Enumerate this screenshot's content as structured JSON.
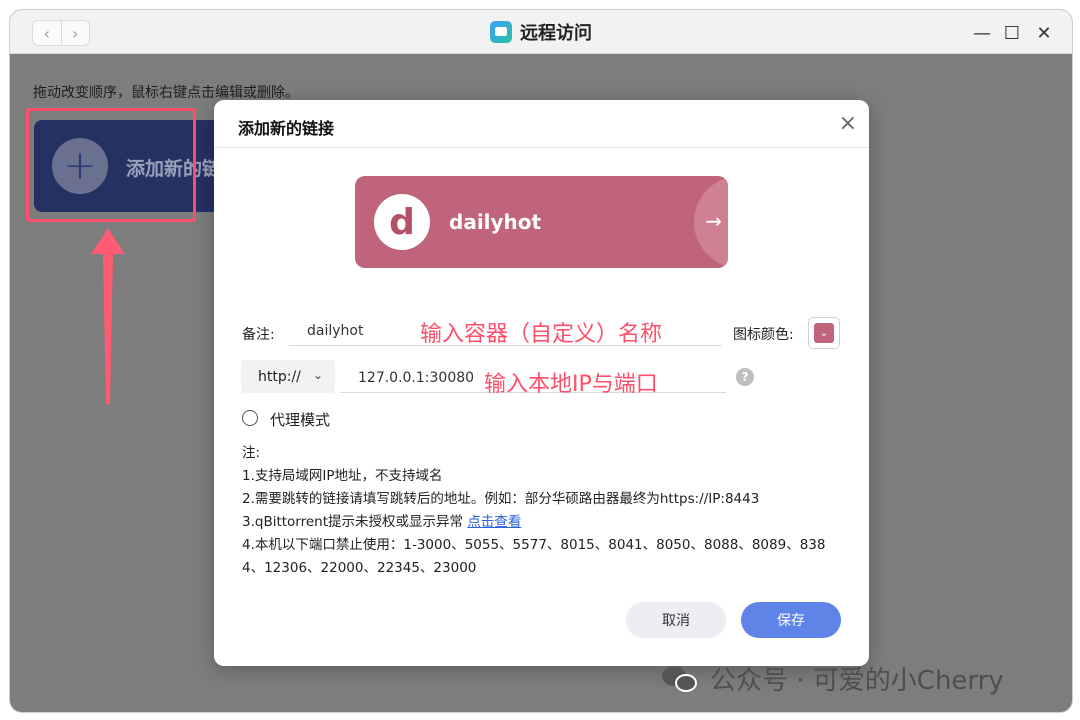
{
  "window": {
    "title": "远程访问",
    "nav_back": "‹",
    "nav_forward": "›",
    "minimize": "—",
    "maximize": "☐",
    "close": "✕"
  },
  "page": {
    "hint": "拖动改变顺序，鼠标右键点击编辑或删除。",
    "add_tile_label": "添加新的链",
    "add_tile_plus": "+"
  },
  "dialog": {
    "title": "添加新的链接",
    "close": "×",
    "preview": {
      "avatar_letter": "d",
      "name": "dailyhot",
      "arrow": "→"
    },
    "remark": {
      "label": "备注:",
      "value": "dailyhot",
      "annotation": "输入容器（自定义）名称"
    },
    "icon_color": {
      "label": "图标颜色:",
      "value": "#c0647b"
    },
    "address": {
      "protocol": "http://",
      "value": "127.0.0.1:30080",
      "annotation": "输入本地IP与端口",
      "help": "?"
    },
    "proxy_mode": {
      "label": "代理模式",
      "checked": false
    },
    "notes": {
      "heading": "注:",
      "line1": "1.支持局域网IP地址，不支持域名",
      "line2": "2.需要跳转的链接请填写跳转后的地址。例如：部分华硕路由器最终为https://IP:8443",
      "line3_prefix": "3.qBittorrent提示未授权或显示异常 ",
      "line3_link": "点击查看",
      "line4": "4.本机以下端口禁止使用：1-3000、5055、5577、8015、8041、8050、8088、8089、838",
      "line5": "4、12306、22000、22345、23000"
    },
    "cancel_label": "取消",
    "save_label": "保存"
  },
  "watermark": {
    "text": "公众号 · 可爱的小Cherry"
  },
  "colors": {
    "accent": "#5d84e6",
    "annotation": "#ff4f6a",
    "preview_card": "#c0647b",
    "tile": "#253163"
  }
}
